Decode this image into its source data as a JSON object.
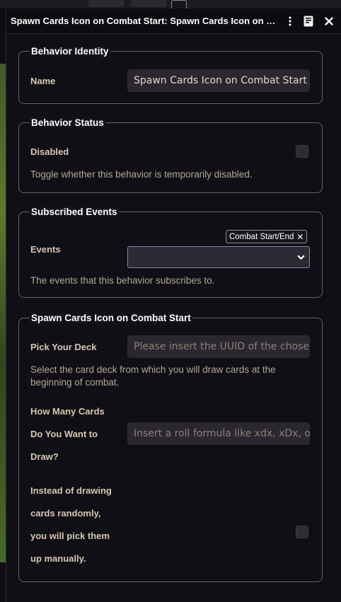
{
  "window": {
    "title": "Spawn Cards Icon on Combat Start: Spawn Cards Icon on Co...",
    "icons": [
      "kebab-menu-icon",
      "sheet-icon",
      "close-icon"
    ]
  },
  "identity": {
    "legend": "Behavior Identity",
    "name_label": "Name",
    "name_value": "Spawn Cards Icon on Combat Start"
  },
  "status": {
    "legend": "Behavior Status",
    "disabled_label": "Disabled",
    "disabled_checked": false,
    "hint": "Toggle whether this behavior is temporarily disabled."
  },
  "events": {
    "legend": "Subscribed Events",
    "events_label": "Events",
    "selected_tag": "Combat Start/End",
    "tag_remove": "✕",
    "select_value": "",
    "hint": "The events that this behavior subscribes to."
  },
  "spawn": {
    "legend": "Spawn Cards Icon on Combat Start",
    "deck_label": "Pick Your Deck",
    "deck_placeholder": "Please insert the UUID of the chosen",
    "deck_hint_1": "Select the card deck from which you will draw cards at the",
    "deck_hint_2": "beginning of combat.",
    "count_label_1": "How Many Cards",
    "count_label_2": "Do You Want to",
    "count_label_3": "Draw?",
    "count_placeholder": "Insert a roll formula like xdx, xDx, or",
    "manual_label_1": "Instead of drawing",
    "manual_label_2": "cards randomly,",
    "manual_label_3": "you will pick them",
    "manual_label_4": "up manually.",
    "manual_checked": false
  },
  "colors": {
    "border": "#6e6259",
    "label": "#d7c7b3",
    "accent": "#8a7fb8"
  }
}
